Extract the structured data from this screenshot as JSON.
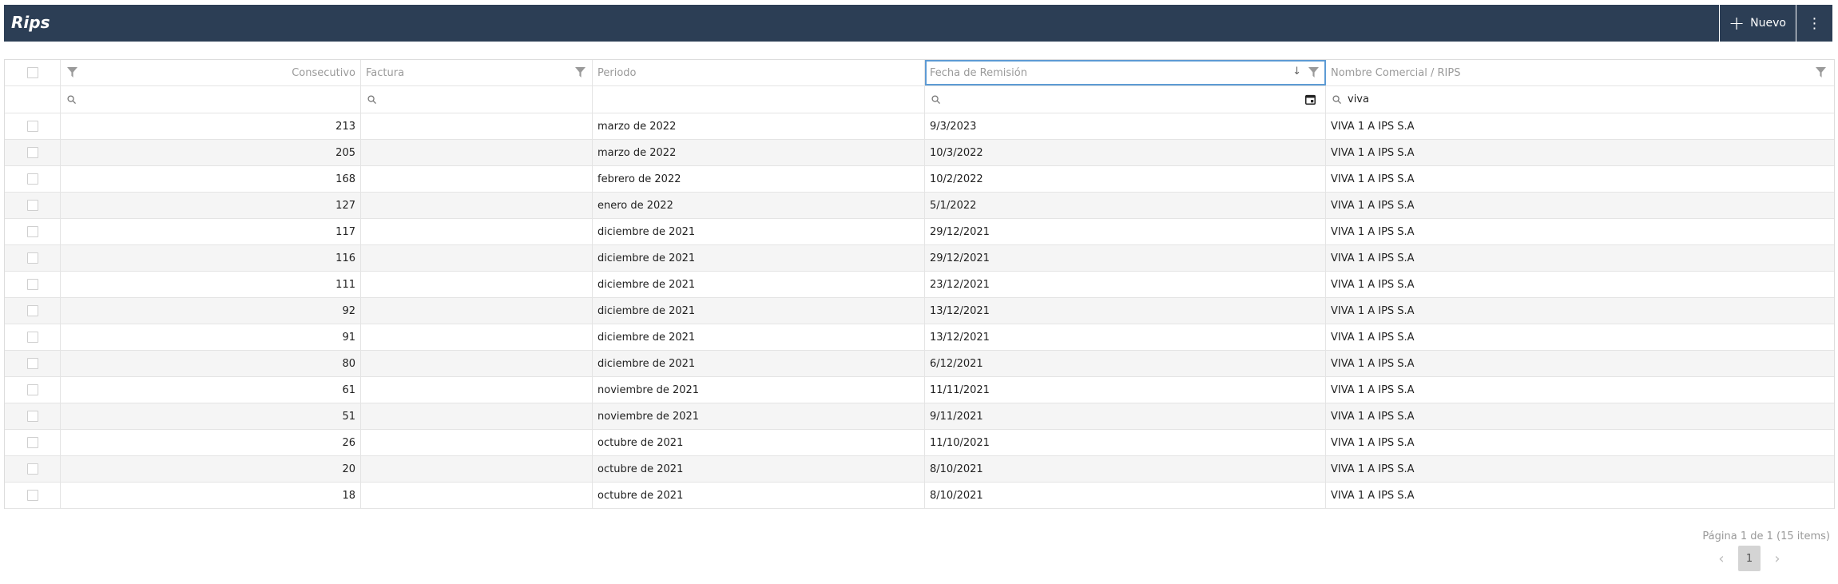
{
  "app": {
    "title": "Rips"
  },
  "toolbar": {
    "new_label": "Nuevo",
    "more_icon": "⋮",
    "plus_icon": "+"
  },
  "columns": {
    "consecutivo": "Consecutivo",
    "factura": "Factura",
    "periodo": "Periodo",
    "fecha": "Fecha de Remisión",
    "nombre": "Nombre Comercial / RIPS"
  },
  "filters": {
    "nombre_value": "viva"
  },
  "rows": [
    {
      "consecutivo": "213",
      "factura": "",
      "periodo": "marzo de 2022",
      "fecha": "9/3/2023",
      "nombre": "VIVA 1 A IPS S.A"
    },
    {
      "consecutivo": "205",
      "factura": "",
      "periodo": "marzo de 2022",
      "fecha": "10/3/2022",
      "nombre": "VIVA 1 A IPS S.A"
    },
    {
      "consecutivo": "168",
      "factura": "",
      "periodo": "febrero de 2022",
      "fecha": "10/2/2022",
      "nombre": "VIVA 1 A IPS S.A"
    },
    {
      "consecutivo": "127",
      "factura": "",
      "periodo": "enero de 2022",
      "fecha": "5/1/2022",
      "nombre": "VIVA 1 A IPS S.A"
    },
    {
      "consecutivo": "117",
      "factura": "",
      "periodo": "diciembre de 2021",
      "fecha": "29/12/2021",
      "nombre": "VIVA 1 A IPS S.A"
    },
    {
      "consecutivo": "116",
      "factura": "",
      "periodo": "diciembre de 2021",
      "fecha": "29/12/2021",
      "nombre": "VIVA 1 A IPS S.A"
    },
    {
      "consecutivo": "111",
      "factura": "",
      "periodo": "diciembre de 2021",
      "fecha": "23/12/2021",
      "nombre": "VIVA 1 A IPS S.A"
    },
    {
      "consecutivo": "92",
      "factura": "",
      "periodo": "diciembre de 2021",
      "fecha": "13/12/2021",
      "nombre": "VIVA 1 A IPS S.A"
    },
    {
      "consecutivo": "91",
      "factura": "",
      "periodo": "diciembre de 2021",
      "fecha": "13/12/2021",
      "nombre": "VIVA 1 A IPS S.A"
    },
    {
      "consecutivo": "80",
      "factura": "",
      "periodo": "diciembre de 2021",
      "fecha": "6/12/2021",
      "nombre": "VIVA 1 A IPS S.A"
    },
    {
      "consecutivo": "61",
      "factura": "",
      "periodo": "noviembre de 2021",
      "fecha": "11/11/2021",
      "nombre": "VIVA 1 A IPS S.A"
    },
    {
      "consecutivo": "51",
      "factura": "",
      "periodo": "noviembre de 2021",
      "fecha": "9/11/2021",
      "nombre": "VIVA 1 A IPS S.A"
    },
    {
      "consecutivo": "26",
      "factura": "",
      "periodo": "octubre de 2021",
      "fecha": "11/10/2021",
      "nombre": "VIVA 1 A IPS S.A"
    },
    {
      "consecutivo": "20",
      "factura": "",
      "periodo": "octubre de 2021",
      "fecha": "8/10/2021",
      "nombre": "VIVA 1 A IPS S.A"
    },
    {
      "consecutivo": "18",
      "factura": "",
      "periodo": "octubre de 2021",
      "fecha": "8/10/2021",
      "nombre": "VIVA 1 A IPS S.A"
    }
  ],
  "pagination": {
    "info": "Página 1 de 1 (15 items)",
    "current_page": "1"
  },
  "colors": {
    "header_bg": "#2c3e55",
    "active_border": "#5d9bd4"
  }
}
